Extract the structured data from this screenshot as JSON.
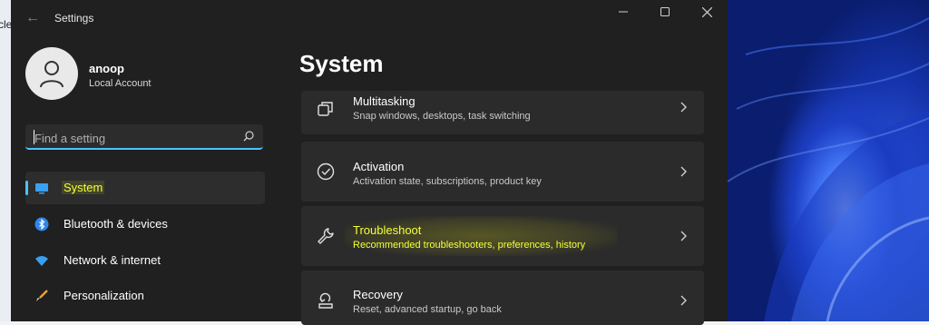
{
  "window": {
    "title": "Settings",
    "back_icon": "back-arrow-icon",
    "controls": [
      "minimize-icon",
      "maximize-icon",
      "close-icon"
    ]
  },
  "desktop": {
    "edge_text": "cle"
  },
  "account": {
    "name": "anoop",
    "type": "Local Account"
  },
  "search": {
    "placeholder": "Find a setting"
  },
  "sidebar": {
    "items": [
      {
        "label": "System",
        "icon": "monitor-icon",
        "active": true
      },
      {
        "label": "Bluetooth & devices",
        "icon": "bluetooth-icon",
        "active": false
      },
      {
        "label": "Network & internet",
        "icon": "wifi-icon",
        "active": false
      },
      {
        "label": "Personalization",
        "icon": "brush-icon",
        "active": false
      }
    ]
  },
  "main": {
    "title": "System",
    "cards": [
      {
        "title": "Multitasking",
        "subtitle": "Snap windows, desktops, task switching",
        "icon": "multitasking-icon"
      },
      {
        "title": "Activation",
        "subtitle": "Activation state, subscriptions, product key",
        "icon": "check-circle-icon"
      },
      {
        "title": "Troubleshoot",
        "subtitle": "Recommended troubleshooters, preferences, history",
        "icon": "wrench-icon",
        "highlighted": true
      },
      {
        "title": "Recovery",
        "subtitle": "Reset, advanced startup, go back",
        "icon": "recovery-icon"
      }
    ]
  },
  "colors": {
    "accent": "#4cc2ff",
    "highlight_text": "#f4ff3a",
    "window_bg": "#202020",
    "card_bg": "#2b2b2b"
  }
}
